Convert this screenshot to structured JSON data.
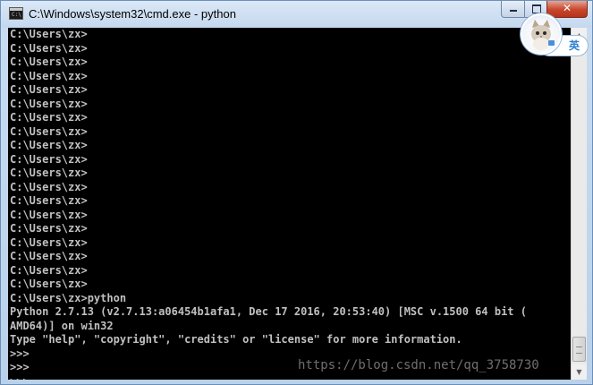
{
  "window": {
    "title": "C:\\Windows\\system32\\cmd.exe - python",
    "app_icon_text": "C:\\",
    "close_glyph": "✕"
  },
  "console": {
    "lines": [
      "C:\\Users\\zx>",
      "C:\\Users\\zx>",
      "C:\\Users\\zx>",
      "C:\\Users\\zx>",
      "C:\\Users\\zx>",
      "C:\\Users\\zx>",
      "C:\\Users\\zx>",
      "C:\\Users\\zx>",
      "C:\\Users\\zx>",
      "C:\\Users\\zx>",
      "C:\\Users\\zx>",
      "C:\\Users\\zx>",
      "C:\\Users\\zx>",
      "C:\\Users\\zx>",
      "C:\\Users\\zx>",
      "C:\\Users\\zx>",
      "C:\\Users\\zx>",
      "C:\\Users\\zx>",
      "C:\\Users\\zx>",
      "C:\\Users\\zx>python",
      "Python 2.7.13 (v2.7.13:a06454b1afa1, Dec 17 2016, 20:53:40) [MSC v.1500 64 bit (",
      "AMD64)] on win32",
      "Type \"help\", \"copyright\", \"credits\" or \"license\" for more information.",
      ">>>",
      ">>>",
      ">>>"
    ],
    "text_color": "#c0c0c0",
    "background_color": "#000000"
  },
  "ime": {
    "language_label": "英",
    "avatar_icon": "cat-avatar-icon"
  },
  "scrollbar": {
    "up_glyph": "▲",
    "down_glyph": "▼"
  },
  "watermark": {
    "text": "https://blog.csdn.net/qq_3758730"
  }
}
